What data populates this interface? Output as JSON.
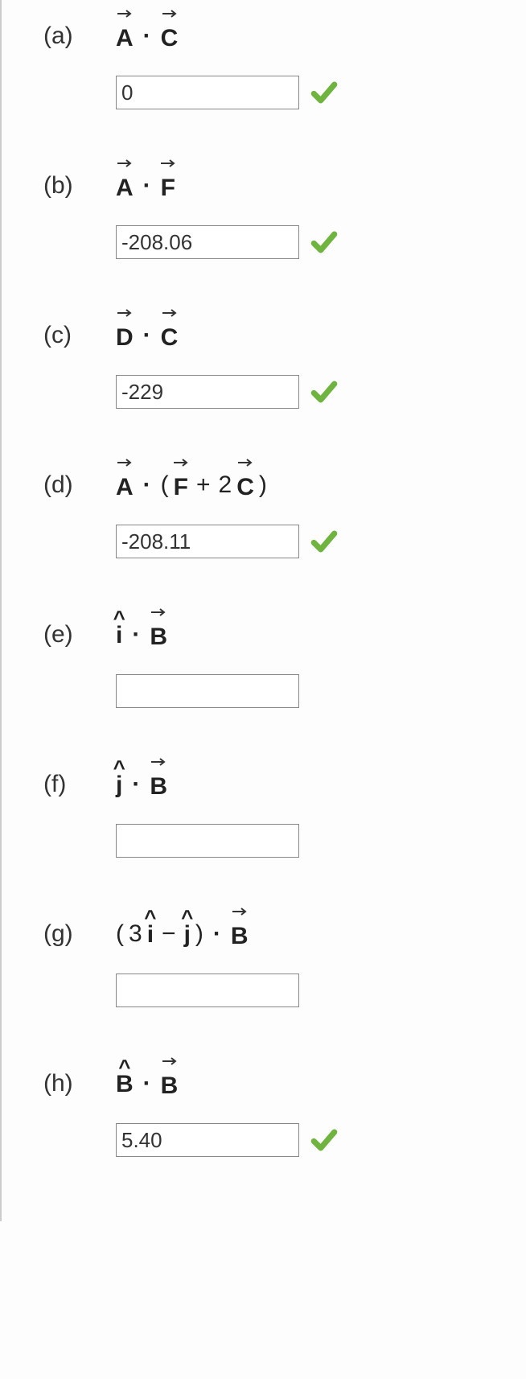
{
  "parts": {
    "a": {
      "label": "(a)",
      "value": "0",
      "correct": true
    },
    "b": {
      "label": "(b)",
      "value": "-208.06",
      "correct": true
    },
    "c": {
      "label": "(c)",
      "value": "-229",
      "correct": true
    },
    "d": {
      "label": "(d)",
      "value": "-208.11",
      "correct": true
    },
    "e": {
      "label": "(e)",
      "value": "",
      "correct": false
    },
    "f": {
      "label": "(f)",
      "value": "",
      "correct": false
    },
    "g": {
      "label": "(g)",
      "value": "",
      "correct": false
    },
    "h": {
      "label": "(h)",
      "value": "5.40",
      "correct": true
    }
  },
  "symbols": {
    "A": "A",
    "B": "B",
    "C": "C",
    "D": "D",
    "F": "F",
    "i": "i",
    "j": "j",
    "dot": "·",
    "plus": "+",
    "minus": "−",
    "two": "2",
    "three": "3",
    "lparen": "(",
    "rparen": ")"
  }
}
